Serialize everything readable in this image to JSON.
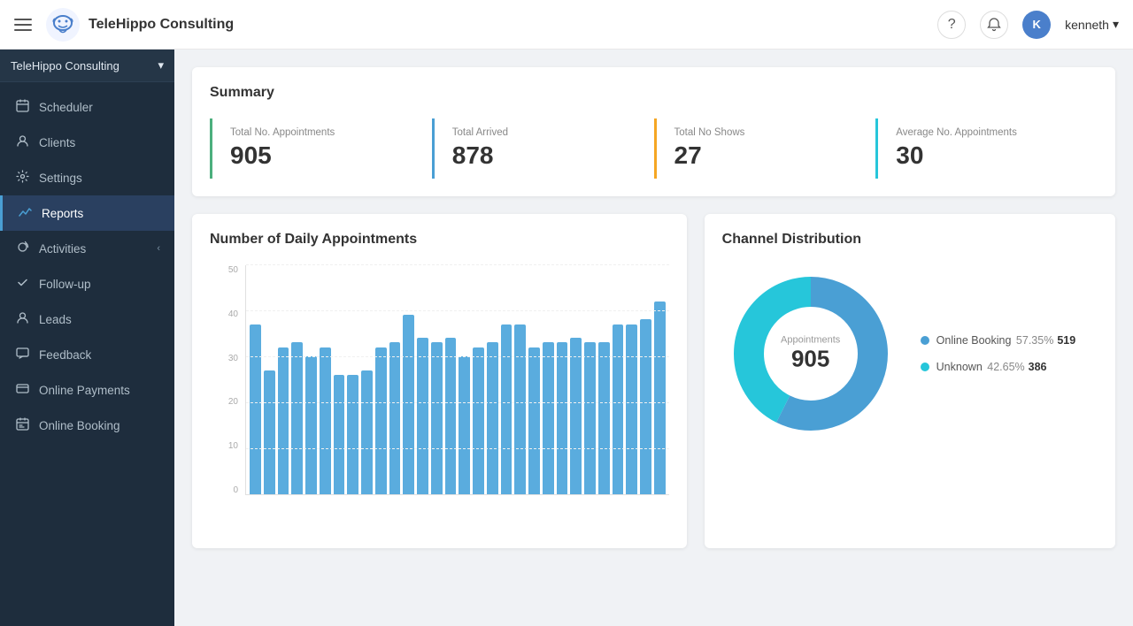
{
  "header": {
    "hamburger_label": "menu",
    "app_title": "TeleHippo Consulting",
    "help_icon": "?",
    "bell_icon": "🔔",
    "avatar_initials": "K",
    "user_name": "kenneth",
    "chevron": "▾"
  },
  "sidebar": {
    "org_name": "TeleHippo Consulting",
    "org_chevron": "▾",
    "nav_items": [
      {
        "id": "scheduler",
        "label": "Scheduler",
        "icon": "📅"
      },
      {
        "id": "clients",
        "label": "Clients",
        "icon": "📞"
      },
      {
        "id": "settings",
        "label": "Settings",
        "icon": "⚙"
      },
      {
        "id": "reports",
        "label": "Reports",
        "icon": "📈"
      },
      {
        "id": "activities",
        "label": "Activities",
        "icon": "🔄",
        "has_chevron": true
      },
      {
        "id": "follow-up",
        "label": "Follow-up",
        "icon": "➤"
      },
      {
        "id": "leads",
        "label": "Leads",
        "icon": "👤"
      },
      {
        "id": "feedback",
        "label": "Feedback",
        "icon": "✉"
      },
      {
        "id": "online-payments",
        "label": "Online Payments",
        "icon": "💳"
      },
      {
        "id": "online-booking",
        "label": "Online Booking",
        "icon": "📆"
      }
    ]
  },
  "summary": {
    "title": "Summary",
    "stats": [
      {
        "label": "Total No. Appointments",
        "value": "905",
        "color": "#4caf7d"
      },
      {
        "label": "Total Arrived",
        "value": "878",
        "color": "#4a9fd4"
      },
      {
        "label": "Total No Shows",
        "value": "27",
        "color": "#f5a623"
      },
      {
        "label": "Average No. Appointments",
        "value": "30",
        "color": "#26c6da"
      }
    ]
  },
  "bar_chart": {
    "title": "Number of Daily Appointments",
    "y_labels": [
      "0",
      "10",
      "20",
      "30",
      "40",
      "50"
    ],
    "bars": [
      37,
      27,
      32,
      33,
      30,
      32,
      26,
      26,
      27,
      32,
      33,
      39,
      34,
      33,
      34,
      30,
      32,
      33,
      37,
      37,
      32,
      33,
      33,
      34,
      33,
      33,
      37,
      37,
      38,
      42
    ]
  },
  "donut_chart": {
    "title": "Channel Distribution",
    "center_label": "Appointments",
    "center_value": "905",
    "segments": [
      {
        "label": "Online Booking",
        "percent": "57.35%",
        "count": "519",
        "color": "#4a9fd4"
      },
      {
        "label": "Unknown",
        "percent": "42.65%",
        "count": "386",
        "color": "#26c6da"
      }
    ]
  }
}
